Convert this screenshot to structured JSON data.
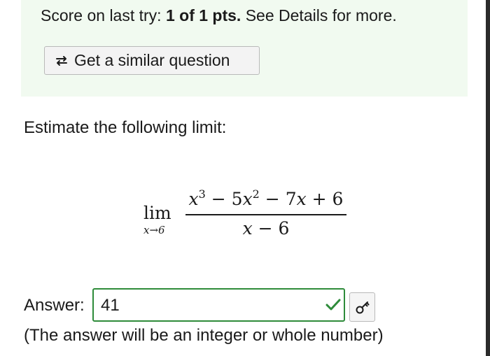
{
  "score": {
    "prefix": "Score on last try: ",
    "points": "1 of 1 pts.",
    "suffix": " See Details for more."
  },
  "similar_button": {
    "label": "Get a similar question",
    "icon": "swap-arrows-icon"
  },
  "question": {
    "prompt": "Estimate the following limit:",
    "math": {
      "lim": "lim",
      "lim_sub": "x→6",
      "numerator": "x3 − 5x2 − 7x + 6",
      "denominator": "x − 6"
    }
  },
  "answer": {
    "label": "Answer:",
    "value": "41",
    "status_icon": "checkmark-icon",
    "status_color": "#2e8b3a",
    "key_icon": "key-icon",
    "hint": "(The answer will be an integer or whole number)"
  }
}
